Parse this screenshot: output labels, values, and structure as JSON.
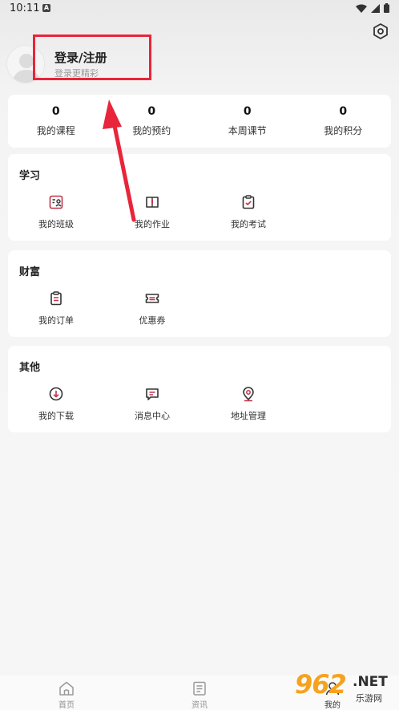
{
  "status_bar": {
    "time": "10:11",
    "notification_icon": "a-icon"
  },
  "header": {
    "login_title": "登录/注册",
    "login_subtitle": "登录更精彩"
  },
  "stats": [
    {
      "value": "0",
      "label": "我的课程"
    },
    {
      "value": "0",
      "label": "我的预约"
    },
    {
      "value": "0",
      "label": "本周课节"
    },
    {
      "value": "0",
      "label": "我的积分"
    }
  ],
  "sections": {
    "study": {
      "title": "学习",
      "items": [
        {
          "label": "我的班级",
          "icon": "class-icon"
        },
        {
          "label": "我的作业",
          "icon": "homework-icon"
        },
        {
          "label": "我的考试",
          "icon": "exam-icon"
        }
      ]
    },
    "wealth": {
      "title": "财富",
      "items": [
        {
          "label": "我的订单",
          "icon": "order-icon"
        },
        {
          "label": "优惠券",
          "icon": "coupon-icon"
        }
      ]
    },
    "other": {
      "title": "其他",
      "items": [
        {
          "label": "我的下载",
          "icon": "download-icon"
        },
        {
          "label": "消息中心",
          "icon": "message-icon"
        },
        {
          "label": "地址管理",
          "icon": "location-icon"
        }
      ]
    }
  },
  "tabbar": [
    {
      "label": "首页",
      "icon": "home-icon"
    },
    {
      "label": "资讯",
      "icon": "news-icon"
    },
    {
      "label": "我的",
      "icon": "profile-icon"
    }
  ],
  "watermark": {
    "number": "962",
    "domain": ".NET",
    "cn": "乐游网"
  },
  "colors": {
    "accent": "#c2334a",
    "highlight": "#e8253a",
    "watermark": "#f6a21e"
  }
}
